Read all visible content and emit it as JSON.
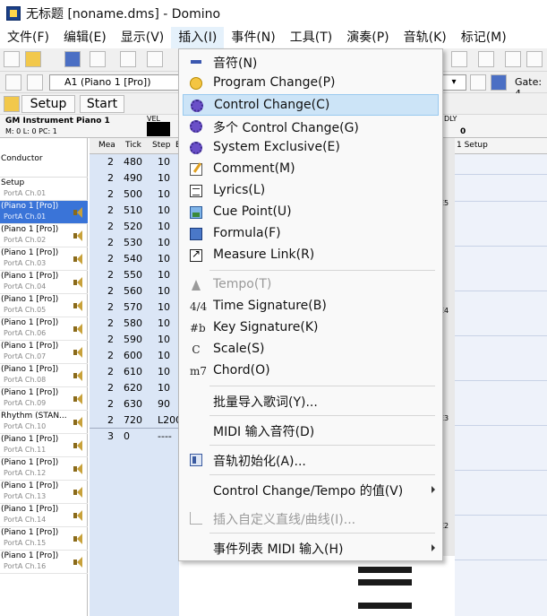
{
  "window": {
    "title": "无标题 [noname.dms] - Domino"
  },
  "menubar": [
    {
      "label": "文件(F)"
    },
    {
      "label": "编辑(E)"
    },
    {
      "label": "显示(V)"
    },
    {
      "label": "插入(I)"
    },
    {
      "label": "事件(N)"
    },
    {
      "label": "工具(T)"
    },
    {
      "label": "演奏(P)"
    },
    {
      "label": "音轨(K)"
    },
    {
      "label": "标记(M)"
    }
  ],
  "toolbar2": {
    "track_combo": "A1 (Piano 1 [Pro])",
    "gate_label": "Gate: 4"
  },
  "toolbar3": {
    "setup_label": "Setup",
    "start_label": "Start"
  },
  "instrument": {
    "name": "GM Instrument Piano 1",
    "sub": "M: 0  L: 0  PC: 1",
    "vel_label": "VEL",
    "dly_label": "DLY",
    "dly_value": "0"
  },
  "tracks": {
    "conductor": "Conductor",
    "setup": {
      "name": "Setup",
      "port": "PortA Ch.01"
    },
    "rows": [
      {
        "name": "(Piano 1 [Pro])",
        "port": "PortA Ch.01"
      },
      {
        "name": "(Piano 1 [Pro])",
        "port": "PortA Ch.02"
      },
      {
        "name": "(Piano 1 [Pro])",
        "port": "PortA Ch.03"
      },
      {
        "name": "(Piano 1 [Pro])",
        "port": "PortA Ch.04"
      },
      {
        "name": "(Piano 1 [Pro])",
        "port": "PortA Ch.05"
      },
      {
        "name": "(Piano 1 [Pro])",
        "port": "PortA Ch.06"
      },
      {
        "name": "(Piano 1 [Pro])",
        "port": "PortA Ch.07"
      },
      {
        "name": "(Piano 1 [Pro])",
        "port": "PortA Ch.08"
      },
      {
        "name": "(Piano 1 [Pro])",
        "port": "PortA Ch.09"
      },
      {
        "name": "Rhythm (STAN...",
        "port": "PortA Ch.10"
      },
      {
        "name": "(Piano 1 [Pro])",
        "port": "PortA Ch.11"
      },
      {
        "name": "(Piano 1 [Pro])",
        "port": "PortA Ch.12"
      },
      {
        "name": "(Piano 1 [Pro])",
        "port": "PortA Ch.13"
      },
      {
        "name": "(Piano 1 [Pro])",
        "port": "PortA Ch.14"
      },
      {
        "name": "(Piano 1 [Pro])",
        "port": "PortA Ch.15"
      },
      {
        "name": "(Piano 1 [Pro])",
        "port": "PortA Ch.16"
      }
    ]
  },
  "event_list": {
    "headers": [
      "Mea",
      "Tick",
      "Step",
      "E"
    ],
    "rows": [
      {
        "mea": "2",
        "tick": "480",
        "step": "10"
      },
      {
        "mea": "2",
        "tick": "490",
        "step": "10"
      },
      {
        "mea": "2",
        "tick": "500",
        "step": "10"
      },
      {
        "mea": "2",
        "tick": "510",
        "step": "10"
      },
      {
        "mea": "2",
        "tick": "520",
        "step": "10"
      },
      {
        "mea": "2",
        "tick": "530",
        "step": "10"
      },
      {
        "mea": "2",
        "tick": "540",
        "step": "10"
      },
      {
        "mea": "2",
        "tick": "550",
        "step": "10"
      },
      {
        "mea": "2",
        "tick": "560",
        "step": "10"
      },
      {
        "mea": "2",
        "tick": "570",
        "step": "10"
      },
      {
        "mea": "2",
        "tick": "580",
        "step": "10"
      },
      {
        "mea": "2",
        "tick": "590",
        "step": "10"
      },
      {
        "mea": "2",
        "tick": "600",
        "step": "10"
      },
      {
        "mea": "2",
        "tick": "610",
        "step": "10"
      },
      {
        "mea": "2",
        "tick": "620",
        "step": "10"
      },
      {
        "mea": "2",
        "tick": "630",
        "step": "90"
      },
      {
        "mea": "2",
        "tick": "720",
        "step": "L200"
      },
      {
        "mea": "3",
        "tick": "0",
        "step": "----"
      }
    ]
  },
  "roll": {
    "header": "1 Setup",
    "note_labels": [
      "E5",
      "E4",
      "E3",
      "E2"
    ]
  },
  "insert_menu": {
    "items": [
      {
        "label": "音符(N)",
        "icon": "note-icon"
      },
      {
        "label": "Program Change(P)",
        "icon": "palette-icon"
      },
      {
        "label": "Control Change(C)",
        "icon": "gear-icon",
        "highlighted": true
      },
      {
        "label": "多个 Control Change(G)",
        "icon": "gear-icon"
      },
      {
        "label": "System Exclusive(E)",
        "icon": "gear-icon"
      },
      {
        "label": "Comment(M)",
        "icon": "comment-icon"
      },
      {
        "label": "Lyrics(L)",
        "icon": "lyrics-icon"
      },
      {
        "label": "Cue Point(U)",
        "icon": "picture-icon"
      },
      {
        "label": "Formula(F)",
        "icon": "calculator-icon"
      },
      {
        "label": "Measure Link(R)",
        "icon": "link-icon"
      },
      {
        "label": "Tempo(T)",
        "icon": "tempo-icon",
        "disabled": true
      },
      {
        "label": "Time Signature(B)",
        "icon": "time-signature-icon",
        "glyph": "4/4"
      },
      {
        "label": "Key Signature(K)",
        "icon": "key-signature-icon",
        "glyph": "#b"
      },
      {
        "label": "Scale(S)",
        "icon": "scale-icon",
        "glyph": "C"
      },
      {
        "label": "Chord(O)",
        "icon": "chord-icon",
        "glyph": "m7"
      },
      {
        "label": "批量导入歌词(Y)...",
        "icon": ""
      },
      {
        "label": "MIDI 输入音符(D)",
        "icon": ""
      },
      {
        "label": "音轨初始化(A)...",
        "icon": "grid-icon"
      },
      {
        "label": "Control Change/Tempo 的值(V)",
        "icon": "",
        "submenu": true
      },
      {
        "label": "插入自定义直线/曲线(I)...",
        "icon": "curve-icon",
        "disabled": true
      },
      {
        "label": "事件列表 MIDI 输入(H)",
        "icon": "",
        "submenu": true
      }
    ]
  },
  "colors": {
    "selection": "#3a74d8",
    "menu_highlight": "#cce4f7",
    "event_bg": "#dbe6f6"
  }
}
